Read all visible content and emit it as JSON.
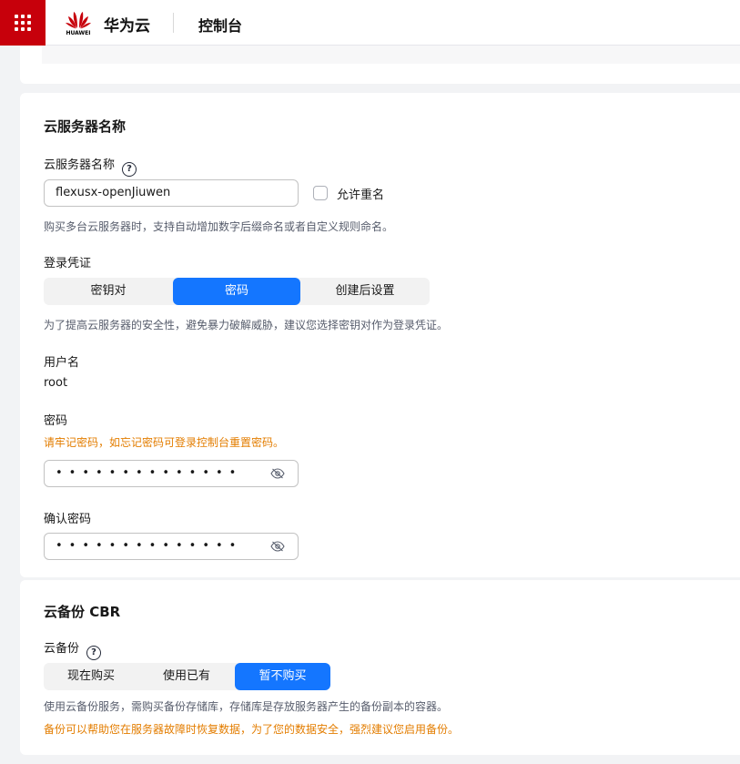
{
  "header": {
    "logo_text": "HUAWEI",
    "brand": "华为云",
    "console": "控制台"
  },
  "server_name_section": {
    "title": "云服务器名称",
    "field_label": "云服务器名称",
    "help": "?",
    "input_value": "flexusx-openJiuwen",
    "allow_duplicate_label": "允许重名",
    "hint": "购买多台云服务器时，支持自动增加数字后缀命名或者自定义规则命名。"
  },
  "login": {
    "label": "登录凭证",
    "options": [
      "密钥对",
      "密码",
      "创建后设置"
    ],
    "selected": "密码",
    "hint": "为了提高云服务器的安全性，避免暴力破解威胁，建议您选择密钥对作为登录凭证。",
    "username_label": "用户名",
    "username_value": "root",
    "password_label": "密码",
    "password_warning": "请牢记密码，如忘记密码可登录控制台重置密码。",
    "password_mask": "••••••••••••••",
    "confirm_label": "确认密码",
    "confirm_mask": "••••••••••••••"
  },
  "backup_section": {
    "title": "云备份 CBR",
    "field_label": "云备份",
    "help": "?",
    "options": [
      "现在购买",
      "使用已有",
      "暂不购买"
    ],
    "selected": "暂不购买",
    "hint": "使用云备份服务，需购买备份存储库，存储库是存放服务器产生的备份副本的容器。",
    "warning": "备份可以帮助您在服务器故障时恢复数据，为了您的数据安全，强烈建议您启用备份。"
  },
  "colors": {
    "brand_red": "#c7000b",
    "primary_blue": "#1476ff",
    "warning_orange": "#e37d00"
  },
  "icons": [
    "app-grid-icon",
    "huawei-logo",
    "help-icon",
    "eye-off-icon"
  ]
}
